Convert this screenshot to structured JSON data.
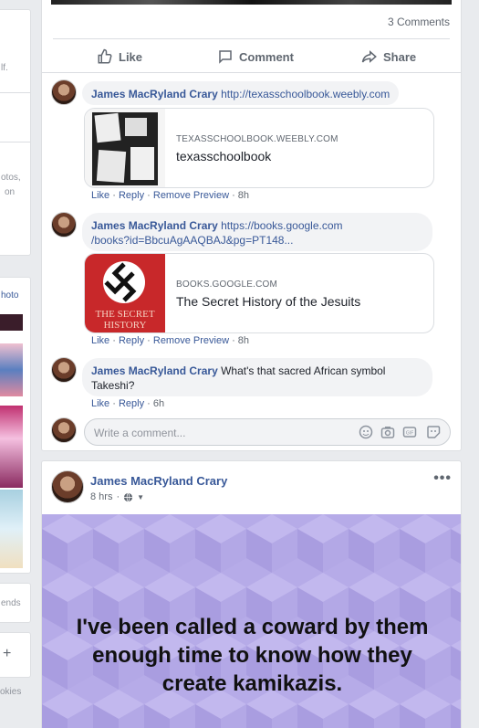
{
  "left_sidebar": {
    "frag1": "lf.",
    "frag2": "otos,",
    "frag3": "on",
    "frag4": "hoto",
    "frag5": "ends",
    "frag6": "okies",
    "plus": "+"
  },
  "post1": {
    "comments_count": "3 Comments",
    "actions": {
      "like": "Like",
      "comment": "Comment",
      "share": "Share"
    },
    "comments": [
      {
        "author": "James MacRyland Crary",
        "text": "http://texasschoolbook.weebly.com",
        "link_domain": "TEXASSCHOOLBOOK.WEEBLY.COM",
        "link_title": "texasschoolbook",
        "like": "Like",
        "reply": "Reply",
        "remove": "Remove Preview",
        "time": "8h"
      },
      {
        "author": "James MacRyland Crary",
        "text_line1": "https://books.google.com",
        "text_line2": "/books?id=BbcuAgAAQBAJ&pg=PT148...",
        "link_domain": "BOOKS.GOOGLE.COM",
        "link_title": "The Secret History of the Jesuits",
        "book_cover": "THE SECRET HISTORY",
        "like": "Like",
        "reply": "Reply",
        "remove": "Remove Preview",
        "time": "8h"
      },
      {
        "author": "James MacRyland Crary",
        "text_line1": "What's that sacred African symbol",
        "text_line2": "Takeshi?",
        "like": "Like",
        "reply": "Reply",
        "time": "6h"
      }
    ],
    "write_placeholder": "Write a comment..."
  },
  "post2": {
    "author": "James MacRyland Crary",
    "time": "8 hrs",
    "more": "•••",
    "text": "I've been called a coward by them enough time to know how they create kamikazis."
  },
  "colors": {
    "link": "#385898",
    "bg": "#e9ebee",
    "post_bg": "#b3a7e6"
  }
}
